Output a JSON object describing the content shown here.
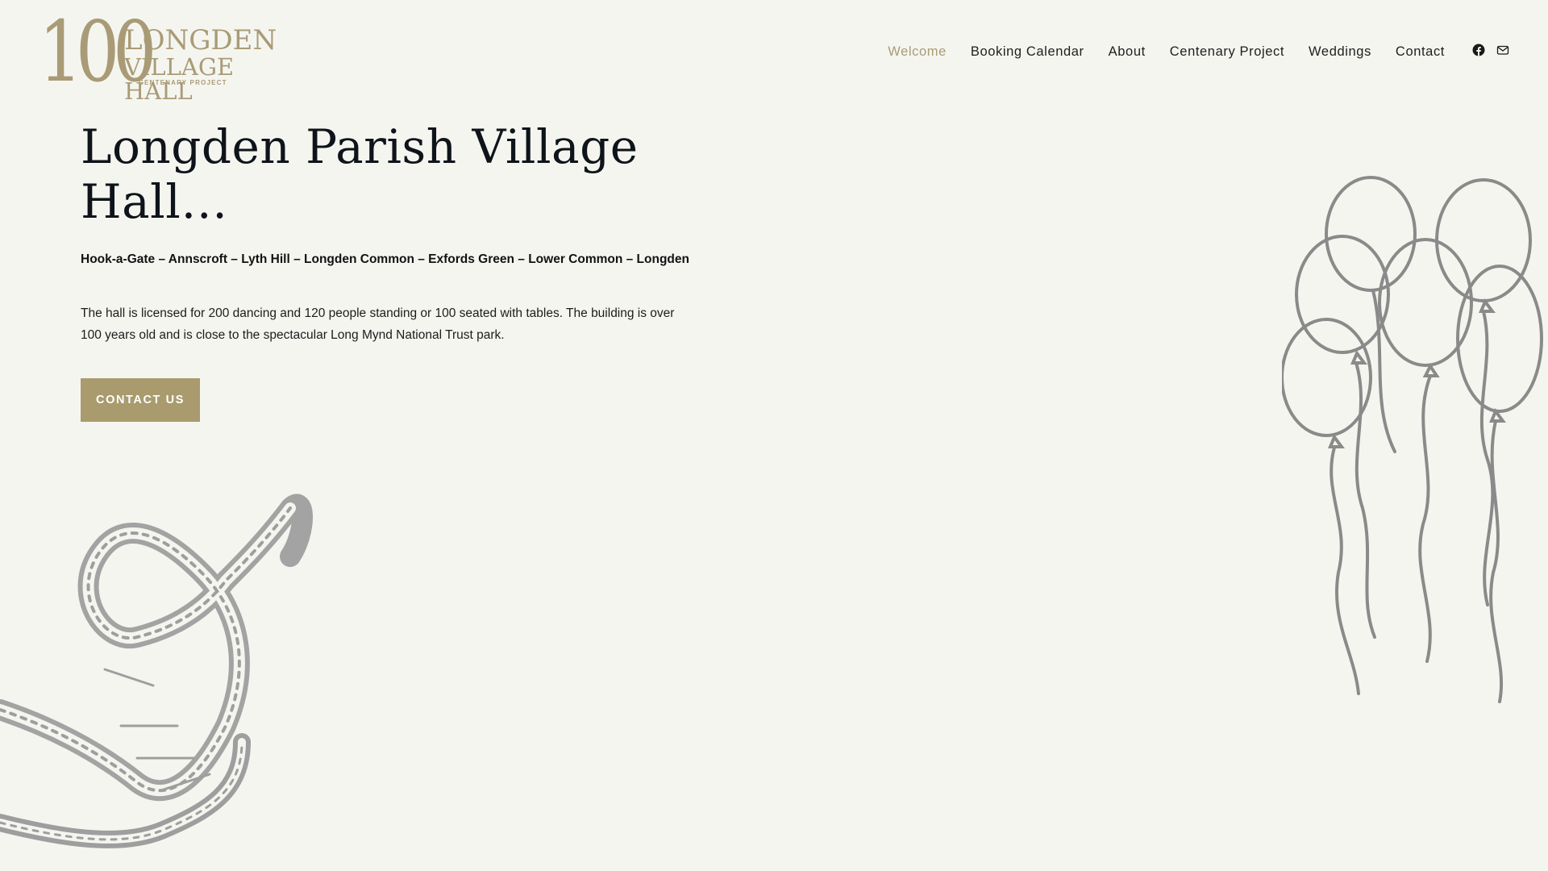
{
  "logo": {
    "number": "100",
    "line1": "LONGDEN",
    "line2": "VILLAGE HALL",
    "line3": "CENTENARY PROJECT"
  },
  "nav": {
    "items": [
      {
        "label": "Welcome",
        "active": true
      },
      {
        "label": "Booking Calendar"
      },
      {
        "label": "About"
      },
      {
        "label": "Centenary Project"
      },
      {
        "label": "Weddings"
      },
      {
        "label": "Contact"
      }
    ],
    "social": [
      "facebook-icon",
      "mail-icon"
    ]
  },
  "hero": {
    "title": "Longden Parish Village Hall…",
    "places": "Hook-a-Gate – Annscroft – Lyth Hill – Longden Common – Exfords Green – Lower Common – Longden",
    "description": "The hall is licensed for 200 dancing and 120 people standing or 100 seated with tables. The building is over 100 years old and is close to the spectacular Long Mynd National Trust park.",
    "cta_label": "CONTACT US"
  },
  "colors": {
    "background": "#f5f5f0",
    "accent": "#a99b6d",
    "heading": "#0e141a",
    "illustration": "#9a9a9a"
  },
  "decorations": [
    "film-strip-illustration",
    "balloons-illustration"
  ]
}
